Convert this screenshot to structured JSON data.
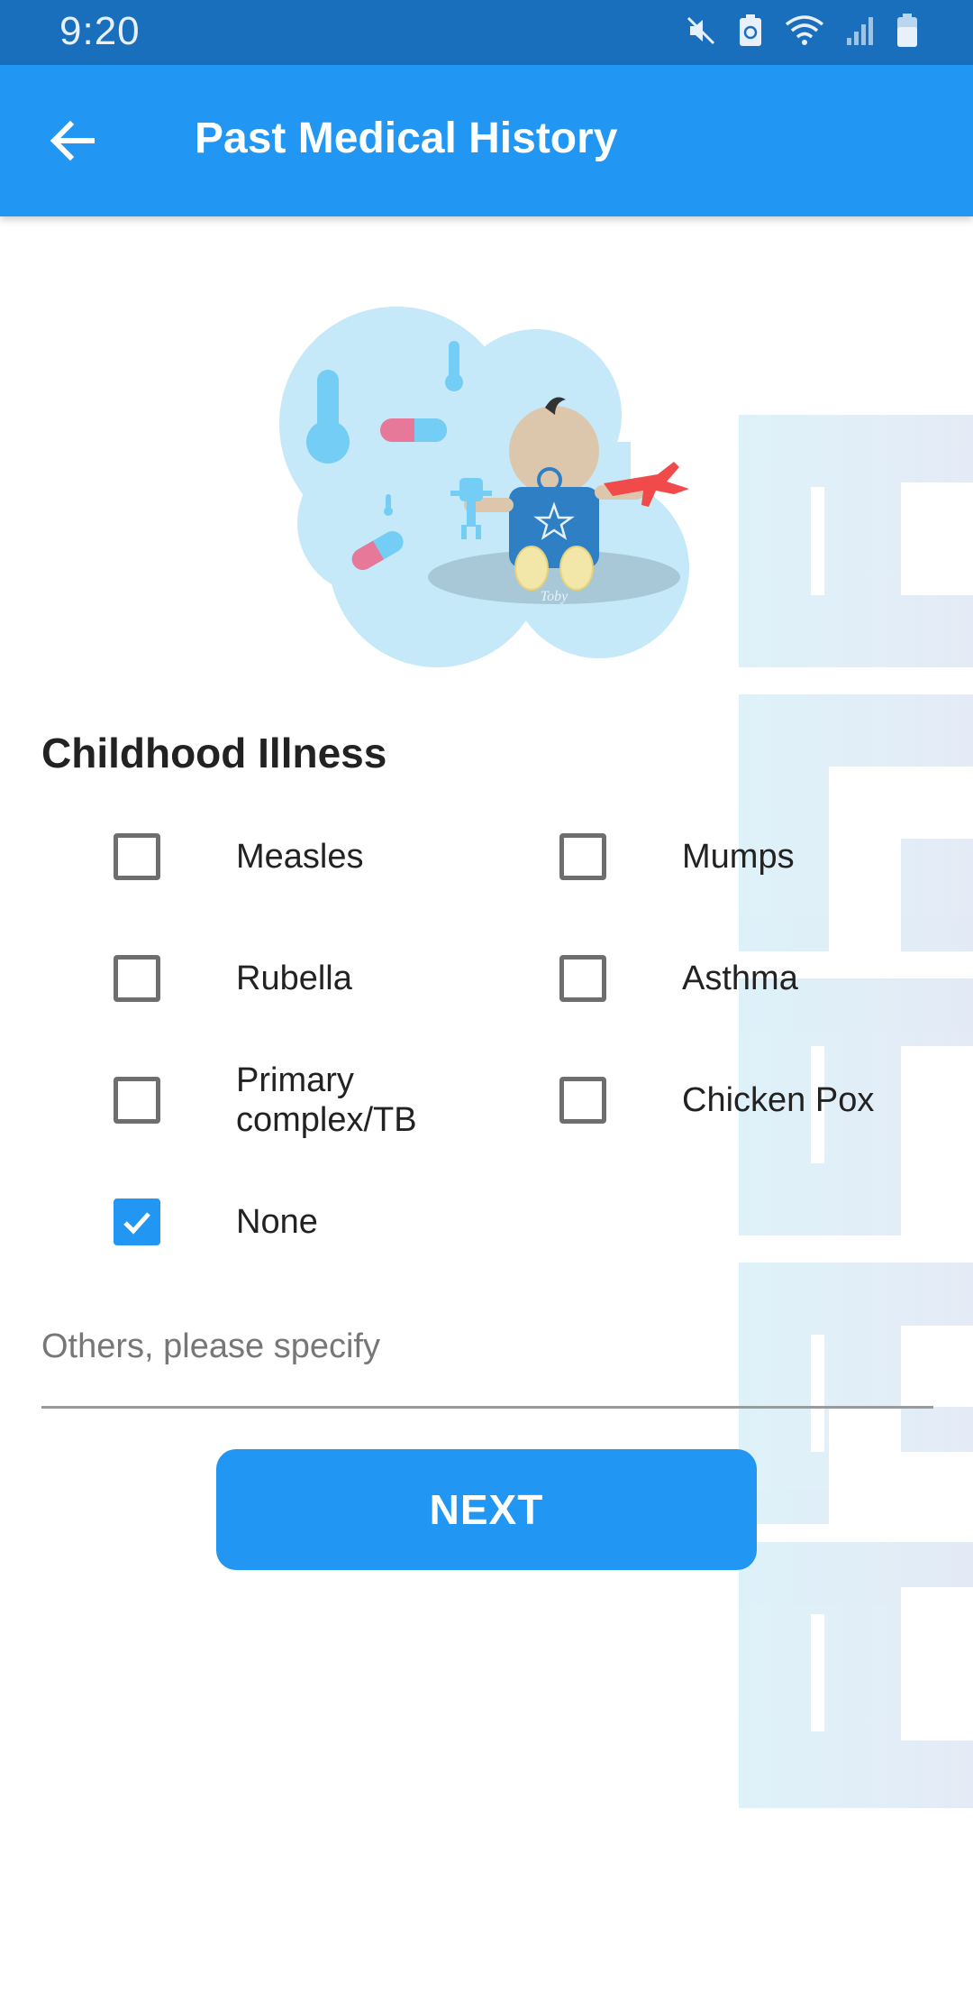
{
  "status_bar": {
    "time": "9:20",
    "icons": [
      "mute-icon",
      "battery-saver-icon",
      "wifi-icon",
      "signal-icon",
      "battery-icon"
    ]
  },
  "app_bar": {
    "back_icon": "arrow-back-icon",
    "title": "Past Medical History"
  },
  "illustration": {
    "caption": "Toby"
  },
  "section": {
    "title": "Childhood Illness"
  },
  "options": [
    {
      "label": "Measles",
      "checked": false
    },
    {
      "label": "Mumps",
      "checked": false
    },
    {
      "label": "Rubella",
      "checked": false
    },
    {
      "label": "Asthma",
      "checked": false
    },
    {
      "label": "Primary\ncomplex/TB",
      "checked": false
    },
    {
      "label": "Chicken Pox",
      "checked": false
    },
    {
      "label": "None",
      "checked": true
    }
  ],
  "others_field": {
    "placeholder": "Others, please specify",
    "value": ""
  },
  "next_button": {
    "label": "NEXT"
  },
  "colors": {
    "status_bar": "#1a6fbd",
    "primary": "#2196f3",
    "checkbox_border": "#6e6e6e"
  }
}
